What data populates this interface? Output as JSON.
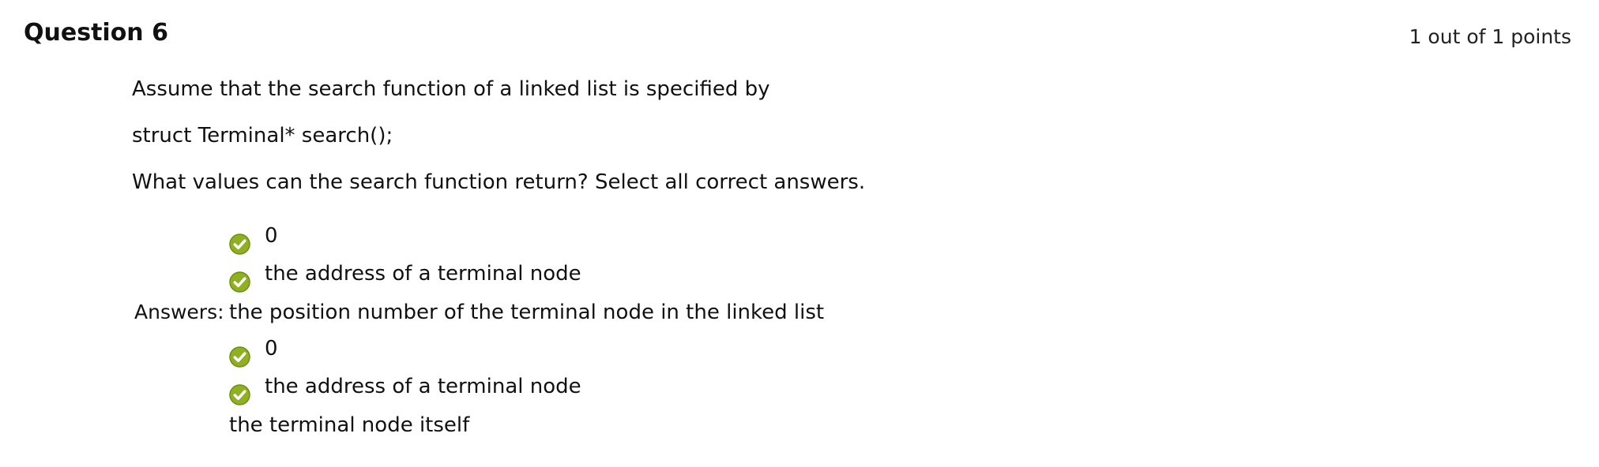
{
  "question": {
    "title": "Question 6",
    "points": "1 out of 1 points",
    "prompt_lines": [
      "Assume that the search function of a linked list is specified by",
      "struct Terminal* search();",
      "What values can the search function return? Select all correct answers."
    ]
  },
  "answers": {
    "label": "Answers:",
    "options": [
      {
        "text": "0",
        "icon": "correct-check-icon",
        "correct": true
      },
      {
        "text": "the address of a terminal node",
        "icon": "correct-check-icon",
        "correct": true
      },
      {
        "text": "the position number of the terminal node in the linked list",
        "icon": "",
        "correct": false
      },
      {
        "text": "0",
        "icon": "correct-check-icon",
        "correct": true
      },
      {
        "text": "the address of a terminal node",
        "icon": "correct-check-icon",
        "correct": true
      },
      {
        "text": "the terminal node itself",
        "icon": "",
        "correct": false
      }
    ]
  },
  "colors": {
    "check_fill": "#8fb021",
    "check_fill_dark": "#6f8c14",
    "check_mark": "#ffffff",
    "text": "#111111"
  }
}
